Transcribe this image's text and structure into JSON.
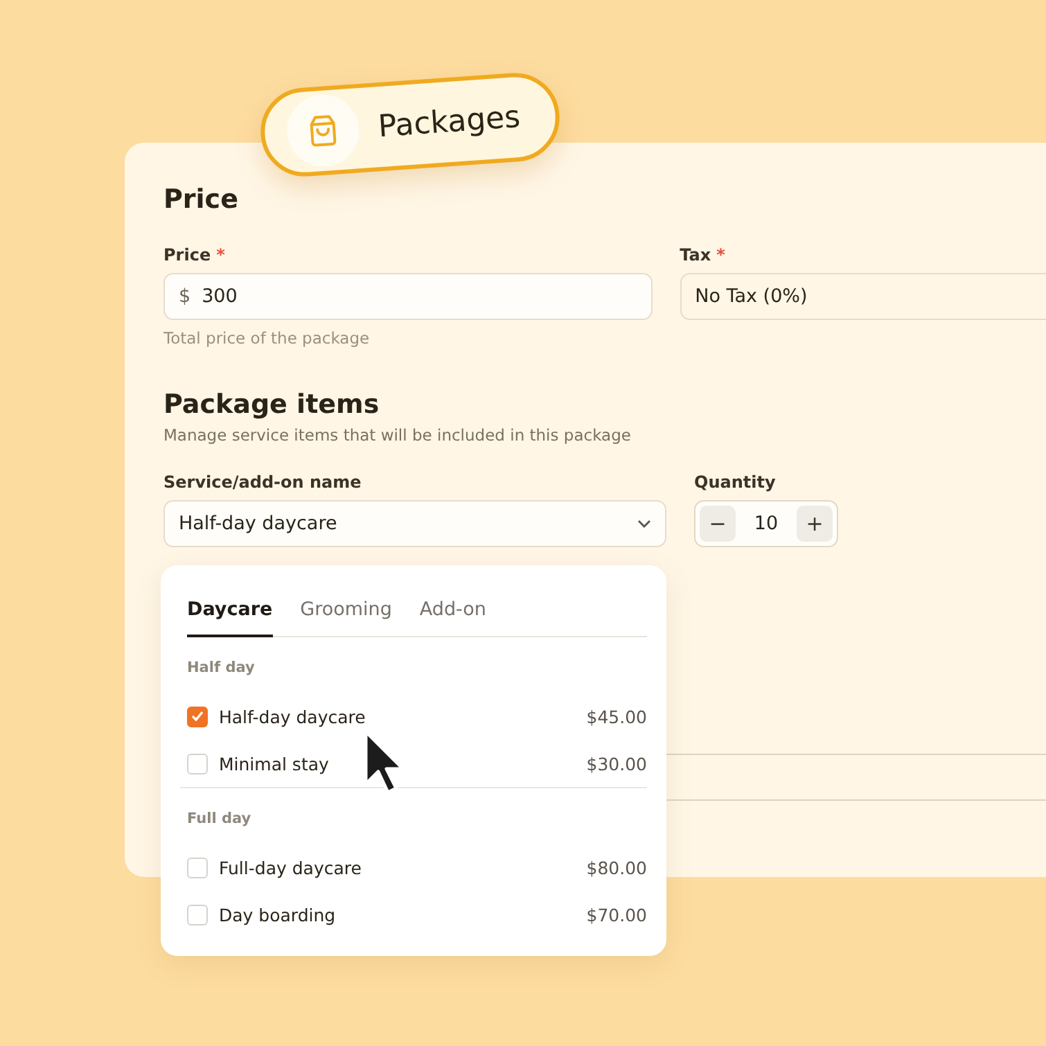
{
  "badge": {
    "label": "Packages"
  },
  "price_section": {
    "title": "Price",
    "price": {
      "label": "Price",
      "required_mark": "*",
      "currency": "$",
      "value": "300",
      "help": "Total price of the package"
    },
    "tax": {
      "label": "Tax",
      "required_mark": "*",
      "value": "No Tax (0%)"
    }
  },
  "items_section": {
    "title": "Package items",
    "subtitle": "Manage service items that will be included in this package",
    "service": {
      "label": "Service/add-on name",
      "value": "Half-day daycare"
    },
    "quantity": {
      "label": "Quantity",
      "minus": "−",
      "value": "10",
      "plus": "+"
    }
  },
  "dropdown": {
    "tabs": [
      {
        "label": "Daycare",
        "selected": true
      },
      {
        "label": "Grooming",
        "selected": false
      },
      {
        "label": "Add-on",
        "selected": false
      }
    ],
    "groups": [
      {
        "title": "Half day",
        "items": [
          {
            "name": "Half-day daycare",
            "price": "$45.00",
            "checked": true
          },
          {
            "name": "Minimal stay",
            "price": "$30.00",
            "checked": false
          }
        ]
      },
      {
        "title": "Full day",
        "items": [
          {
            "name": "Full-day daycare",
            "price": "$80.00",
            "checked": false
          },
          {
            "name": "Day boarding",
            "price": "$70.00",
            "checked": false
          }
        ]
      }
    ]
  }
}
